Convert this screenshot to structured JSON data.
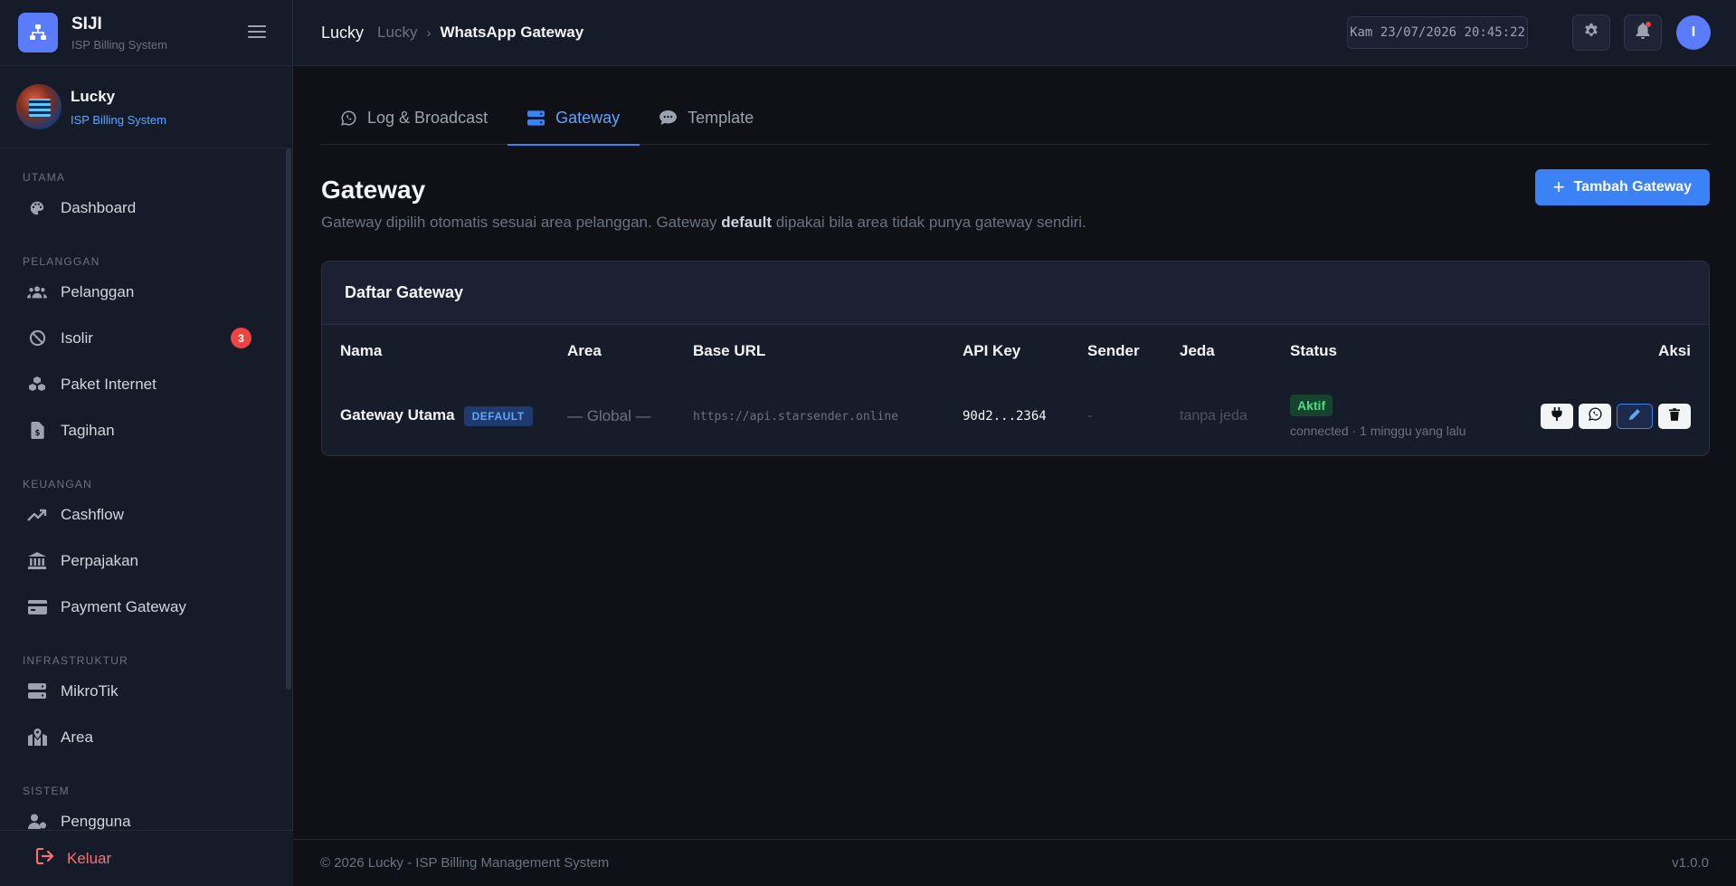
{
  "brand": {
    "name": "SIJI",
    "subtitle": "ISP Billing System"
  },
  "user": {
    "name": "Lucky",
    "role": "ISP Billing System"
  },
  "sidebar": {
    "sections": [
      {
        "title": "UTAMA",
        "items": [
          {
            "label": "Dashboard",
            "icon": "palette-icon"
          }
        ]
      },
      {
        "title": "PELANGGAN",
        "items": [
          {
            "label": "Pelanggan",
            "icon": "users-icon"
          },
          {
            "label": "Isolir",
            "icon": "ban-icon",
            "badge": "3"
          },
          {
            "label": "Paket Internet",
            "icon": "cubes-icon"
          },
          {
            "label": "Tagihan",
            "icon": "invoice-icon"
          }
        ]
      },
      {
        "title": "KEUANGAN",
        "items": [
          {
            "label": "Cashflow",
            "icon": "trend-up-icon"
          },
          {
            "label": "Perpajakan",
            "icon": "bank-icon"
          },
          {
            "label": "Payment Gateway",
            "icon": "credit-card-icon"
          }
        ]
      },
      {
        "title": "INFRASTRUKTUR",
        "items": [
          {
            "label": "MikroTik",
            "icon": "server-icon"
          },
          {
            "label": "Area",
            "icon": "map-icon"
          }
        ]
      },
      {
        "title": "SISTEM",
        "items": [
          {
            "label": "Pengguna",
            "icon": "user-gear-icon"
          }
        ]
      }
    ],
    "logout_label": "Keluar"
  },
  "topbar": {
    "breadcrumb_root": "Lucky",
    "breadcrumb_parent": "Lucky",
    "breadcrumb_current": "WhatsApp Gateway",
    "datetime": "Kam 23/07/2026 20:45:22",
    "avatar_initial": "I"
  },
  "tabs": [
    {
      "label": "Log & Broadcast",
      "active": false
    },
    {
      "label": "Gateway",
      "active": true
    },
    {
      "label": "Template",
      "active": false
    }
  ],
  "page": {
    "title": "Gateway",
    "desc_before": "Gateway dipilih otomatis sesuai area pelanggan. Gateway ",
    "desc_bold": "default",
    "desc_after": " dipakai bila area tidak punya gateway sendiri.",
    "add_button": "Tambah Gateway"
  },
  "table": {
    "title": "Daftar Gateway",
    "columns": [
      "Nama",
      "Area",
      "Base URL",
      "API Key",
      "Sender",
      "Jeda",
      "Status",
      "Aksi"
    ],
    "rows": [
      {
        "name": "Gateway Utama",
        "badge": "DEFAULT",
        "area": "— Global —",
        "base_url": "https://api.starsender.online",
        "api_key": "90d2...2364",
        "sender": "-",
        "jeda": "tanpa jeda",
        "status": "Aktif",
        "status_sub": "connected · 1 minggu yang lalu"
      }
    ]
  },
  "footer": {
    "copyright": "© 2026 Lucky - ISP Billing Management System",
    "version": "v1.0.0"
  },
  "colors": {
    "accent": "#3b82f6",
    "danger": "#ef4444",
    "success": "#4ade80",
    "brand": "#5b7cfa"
  }
}
